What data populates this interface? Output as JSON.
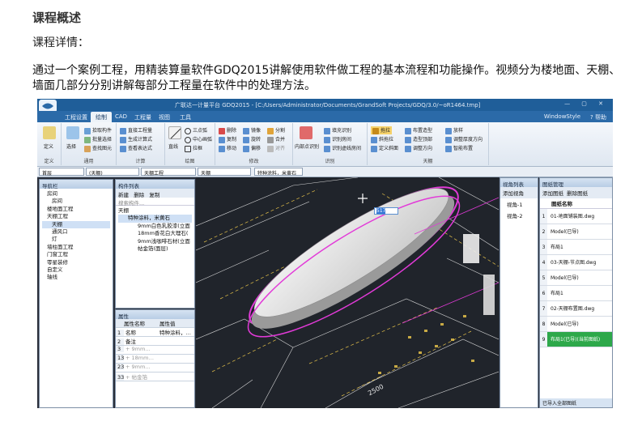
{
  "heading": "课程概述",
  "subheading": "课程详情：",
  "paragraph": "通过一个案例工程，用精装算量软件GDQ2015讲解使用软件做工程的基本流程和功能操作。视频分为楼地面、天棚、墙面几部分分别讲解每部分工程量在软件中的处理方法。",
  "app": {
    "title": "广联达一计量平台 GDQ2015 - [C:/Users/Administrator/Documents/GrandSoft Projects/GDQ/3.0/~oR1464.tmp]",
    "tabs": [
      "工程设置",
      "绘制",
      "CAD",
      "工程量",
      "视图",
      "工具"
    ],
    "active_tab": "绘制",
    "window_style": "WindowStyle",
    "ribbon": {
      "groups": [
        {
          "name": "定义",
          "buttons": [
            "定义"
          ]
        },
        {
          "name": "通用",
          "buttons": [
            "选择",
            "拾取构件",
            "批量选择",
            "查找图元"
          ]
        },
        {
          "name": "计算",
          "buttons": [
            "直接工程量",
            "生成计算式",
            "查看表达式"
          ]
        },
        {
          "name": "绘图",
          "buttons": [
            "直线",
            "三点弧",
            "中心画弧",
            "拉框"
          ]
        },
        {
          "name": "修改",
          "buttons": [
            "删除",
            "镜像",
            "分割",
            "复制",
            "旋转",
            "合并",
            "移动",
            "偏移",
            "对齐"
          ]
        },
        {
          "name": "识别",
          "buttons": [
            "内部点识别",
            "填充识别",
            "识别房间",
            "识别虚线房间"
          ]
        },
        {
          "name": "天棚",
          "buttons": [
            "拖拉",
            "布置造型",
            "放样",
            "斜拖拉",
            "造型顶部",
            "调整厚度方向",
            "定义斜面",
            "调整方向",
            "智能布置"
          ]
        }
      ]
    },
    "filters": [
      "首层",
      "(天棚)",
      "天棚工程",
      "天棚",
      "特种涂料，米黄石"
    ],
    "nav": {
      "title": "导航栏",
      "items": [
        {
          "label": "房间",
          "level": 0
        },
        {
          "label": "房间",
          "level": 1
        },
        {
          "label": "楼地面工程",
          "level": 0
        },
        {
          "label": "天棚工程",
          "level": 0
        },
        {
          "label": "天棚",
          "level": 1,
          "selected": true
        },
        {
          "label": "通风口",
          "level": 1
        },
        {
          "label": "灯",
          "level": 1
        },
        {
          "label": "墙柱面工程",
          "level": 0
        },
        {
          "label": "门窗工程",
          "level": 0
        },
        {
          "label": "零星装修",
          "level": 0
        },
        {
          "label": "自定义",
          "level": 0
        },
        {
          "label": "轴线",
          "level": 0
        }
      ]
    },
    "component_list": {
      "title": "构件列表",
      "actions": [
        "新建",
        "删除",
        "复制"
      ],
      "search_placeholder": "搜索构件...",
      "items": [
        {
          "label": "天棚",
          "level": 0
        },
        {
          "label": "特种涂料，米黄石",
          "level": 1,
          "selected": true
        },
        {
          "label": "9mm白色乳胶漆(立面",
          "level": 2
        },
        {
          "label": "18mm香花白大理石(",
          "level": 2
        },
        {
          "label": "9mm浅咖啡石材(立面",
          "level": 2
        },
        {
          "label": "帖金箔(面层)",
          "level": 2
        }
      ]
    },
    "properties": {
      "title": "属性",
      "columns": [
        "属性名称",
        "属性值"
      ],
      "rows": [
        {
          "no": "1",
          "name": "名称",
          "value": "特种涂料，…"
        },
        {
          "no": "2",
          "name": "备注",
          "value": ""
        },
        {
          "no": "3",
          "name": "+ 9mm…",
          "value": ""
        },
        {
          "no": "13",
          "name": "+ 18mm…",
          "value": ""
        },
        {
          "no": "23",
          "name": "+ 9mm…",
          "value": ""
        },
        {
          "no": "33",
          "name": "+ 帖金箔",
          "value": ""
        }
      ]
    },
    "view_list": {
      "title": "视角列表",
      "action": "添加视角",
      "items": [
        "视角-1",
        "视角-2"
      ]
    },
    "drawing_mgmt": {
      "title": "图纸管理",
      "actions": [
        "添加图纸",
        "删除图纸"
      ],
      "column": "图纸名称",
      "rows": [
        {
          "no": "1",
          "name": "01-地面铺装图.dwg"
        },
        {
          "no": "2",
          "name": "Model(已导)"
        },
        {
          "no": "3",
          "name": "布局1"
        },
        {
          "no": "4",
          "name": "03-天棚-节点图.dwg"
        },
        {
          "no": "5",
          "name": "Model(已导)"
        },
        {
          "no": "6",
          "name": "布局1"
        },
        {
          "no": "7",
          "name": "02-天棚布置图.dwg"
        },
        {
          "no": "8",
          "name": "Model(已导)"
        },
        {
          "no": "9",
          "name": "布局1(已导)(当前图纸)",
          "selected": true
        }
      ],
      "bottom_button": "已导入全部图纸"
    },
    "canvas": {
      "input_value": "517",
      "dimension": "2500"
    },
    "colors": {
      "accent": "#2b6aa8",
      "highlight_row": "#2da84a",
      "magenta": "#e23ad8"
    }
  }
}
